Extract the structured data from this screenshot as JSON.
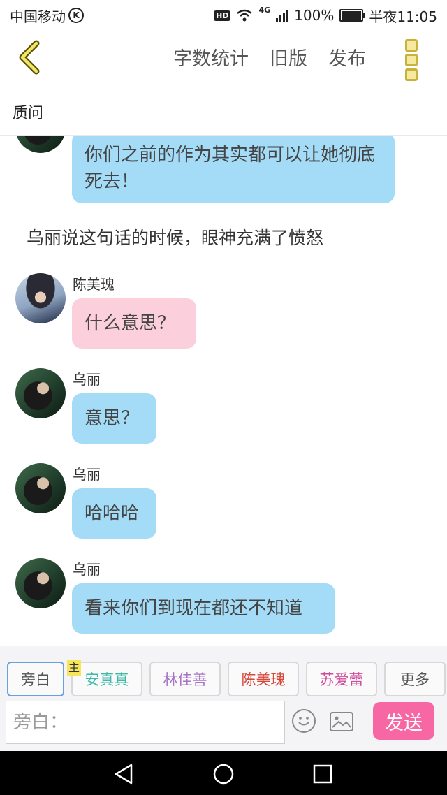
{
  "status_bar": {
    "carrier": "中国移动",
    "hd": "HD",
    "network": "4G",
    "battery": "100%",
    "time": "半夜11:05"
  },
  "header": {
    "word_count": "字数统计",
    "old_version": "旧版",
    "publish": "发布"
  },
  "subtitle": "质问",
  "messages": [
    {
      "text": "你们之前的作为其实都可以让她彻底死去！"
    },
    {
      "narration": "乌丽说这句话的时候，眼神充满了愤怒"
    },
    {
      "speaker": "陈美瑰",
      "text": "什么意思？"
    },
    {
      "speaker": "乌丽",
      "text": "意思？"
    },
    {
      "speaker": "乌丽",
      "text": "哈哈哈"
    },
    {
      "speaker": "乌丽",
      "text": "看来你们到现在都还不知道"
    }
  ],
  "roles": [
    {
      "label": "旁白",
      "color": "#555555"
    },
    {
      "label": "安真真",
      "color": "#3fb9a8",
      "badge": "主"
    },
    {
      "label": "林佳善",
      "color": "#a774c8"
    },
    {
      "label": "陈美瑰",
      "color": "#d9473b"
    },
    {
      "label": "苏爱蕾",
      "color": "#d04a9a"
    },
    {
      "label": "更多",
      "color": "#555555"
    }
  ],
  "input": {
    "placeholder": "旁白：",
    "value": ""
  },
  "send_label": "发送",
  "colors": {
    "bubble_blue": "#a4dcf7",
    "bubble_pink": "#fbcfdc",
    "send": "#f767a3"
  }
}
